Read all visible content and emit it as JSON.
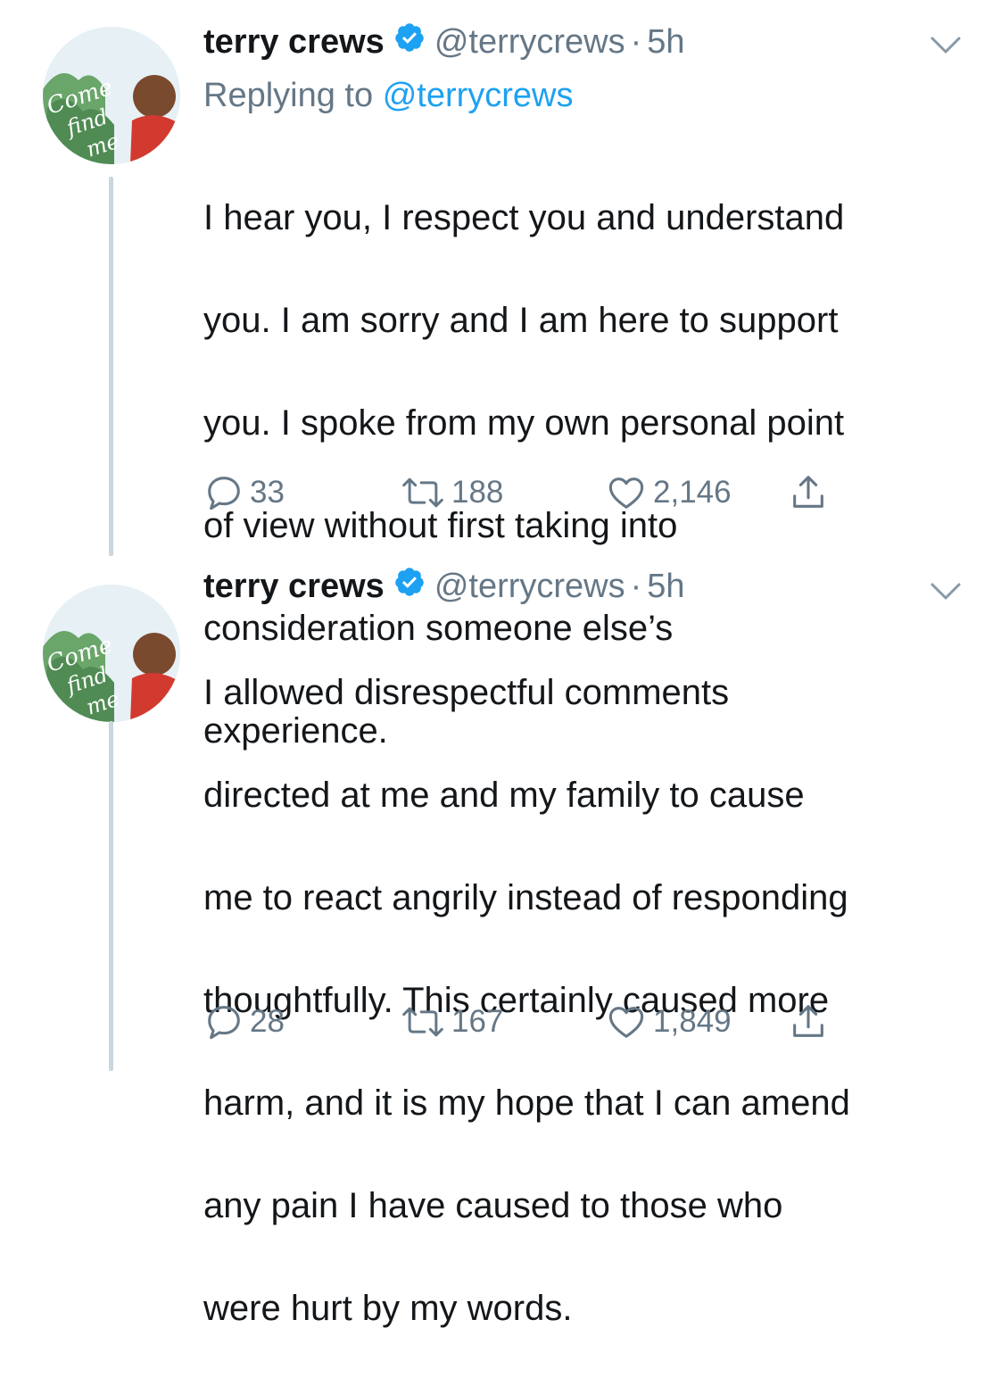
{
  "colors": {
    "name": "#14171a",
    "secondary": "#657786",
    "link": "#1da1f2",
    "thread_line": "#ccd6dd",
    "verified_badge": "#1da1f2"
  },
  "tweets": [
    {
      "display_name": "terry crews",
      "verified_icon": "verified-badge-icon",
      "handle": "@terrycrews",
      "separator": "·",
      "time": "5h",
      "reply_prefix": "Replying to",
      "reply_mention": "@terrycrews",
      "text": "I hear you, I respect you and understand you. I am sorry and I am here to support you.  I spoke from my own personal point of view without first taking into consideration someone else’s experience.",
      "lines": [
        "I hear you, I respect you and understand",
        "you. I am sorry and I am here to support",
        "you.  I spoke from my own personal point",
        "of view without first taking into",
        "consideration someone else’s",
        "experience."
      ],
      "replies": "33",
      "retweets": "188",
      "likes": "2,146",
      "avatar_text": "Come find me"
    },
    {
      "display_name": "terry crews",
      "verified_icon": "verified-badge-icon",
      "handle": "@terrycrews",
      "separator": "·",
      "time": "5h",
      "text": "I allowed disrespectful comments directed at me and my family to cause me to react angrily instead of responding thoughtfully. This certainly caused more harm, and it is my hope that I can amend any pain I have caused to those who were hurt by my words.",
      "lines": [
        "I allowed disrespectful comments",
        "directed at me and my family to cause",
        "me to react angrily instead of responding",
        "thoughtfully. This certainly caused more",
        "harm, and it is my hope that I can amend",
        "any pain I have caused to those who",
        "were hurt by my words."
      ],
      "replies": "28",
      "retweets": "167",
      "likes": "1,849",
      "avatar_text": "Come find me"
    }
  ]
}
